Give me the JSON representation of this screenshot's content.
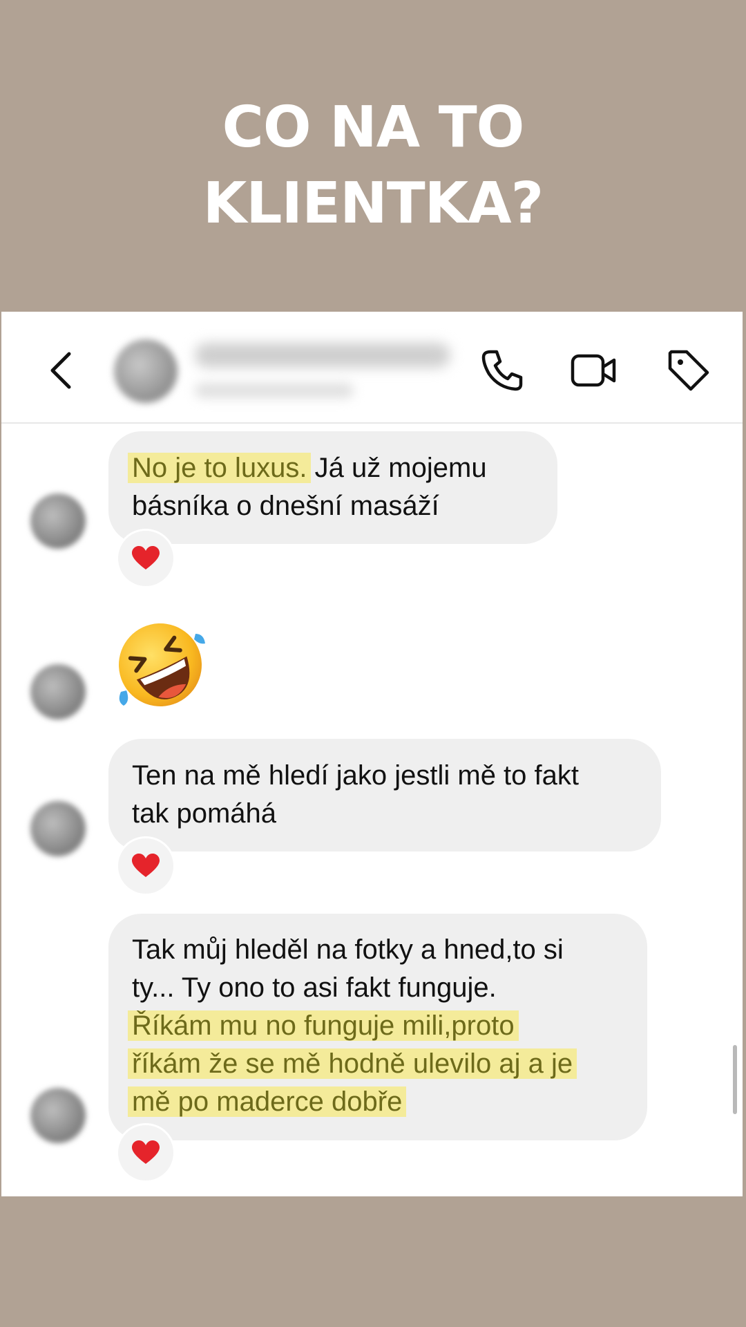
{
  "headline": {
    "line1": "CO NA TO",
    "line2": "KLIENTKA?"
  },
  "header": {
    "back_icon": "chevron-left-icon",
    "call_icon": "phone-icon",
    "video_icon": "video-camera-icon",
    "tag_icon": "tag-icon"
  },
  "messages": [
    {
      "highlight": "No je to luxus.",
      "text_line1_rest": " Já už mojemu",
      "text_line2": "básníka o dnešní masáží",
      "reaction": "red-heart"
    },
    {
      "emoji": "rolling-on-floor-laughing"
    },
    {
      "text_line1": "Ten na mě hledí jako jestli mě to fakt",
      "text_line2": "tak pomáhá",
      "reaction": "red-heart"
    },
    {
      "text_line1": "Tak můj hleděl na fotky a hned,to si",
      "text_line2": "ty... Ty ono to asi fakt funguje.",
      "highlight_line3": "Říkám mu no funguje mili,proto",
      "highlight_line4": "říkám že se mě hodně ulevilo aj a je",
      "highlight_line5": "mě po maderce dobře",
      "reaction": "red-heart"
    }
  ],
  "colors": {
    "background": "#b1a294",
    "bubble": "#efefef",
    "highlight": "#f4eb9a"
  }
}
